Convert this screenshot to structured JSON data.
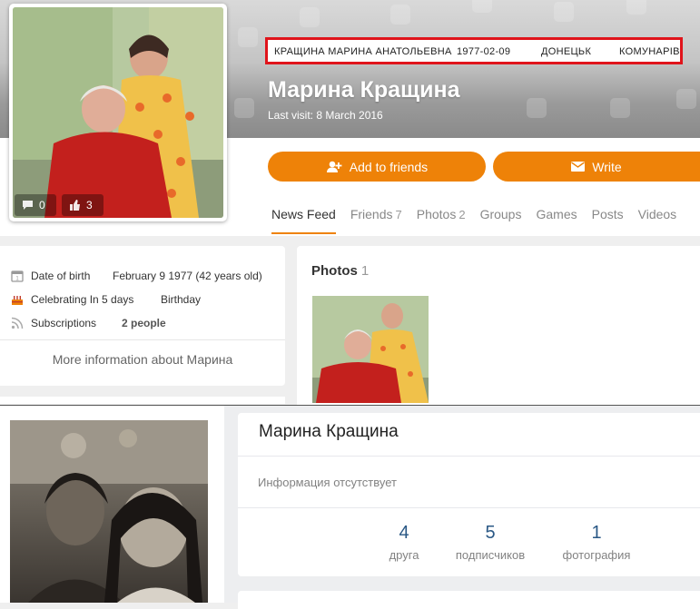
{
  "ok_profile": {
    "highlight": {
      "full_name": "КРАЩИНА МАРИНА АНАТОЛЬЕВНА",
      "dob": "1977-02-09",
      "city": "ДОНЕЦЬК",
      "street": "КОМУНАРІВ"
    },
    "name": "Марина Кращина",
    "last_visit": "Last visit: 8 March 2016",
    "avatar_comments": "0",
    "avatar_likes": "3",
    "add_friends_label": "Add to friends",
    "write_label": "Write",
    "tabs": [
      {
        "label": "News Feed",
        "count": ""
      },
      {
        "label": "Friends",
        "count": "7"
      },
      {
        "label": "Photos",
        "count": "2"
      },
      {
        "label": "Groups",
        "count": ""
      },
      {
        "label": "Games",
        "count": ""
      },
      {
        "label": "Posts",
        "count": ""
      },
      {
        "label": "Videos",
        "count": ""
      }
    ],
    "details": [
      {
        "icon": "calendar-icon",
        "label": "Date of birth",
        "value": "February 9 1977 (42 years old)"
      },
      {
        "icon": "cake-icon",
        "label": "Celebrating In 5 days",
        "value": "Birthday"
      },
      {
        "icon": "rss-icon",
        "label": "Subscriptions",
        "value": "2 people"
      }
    ],
    "more_info": "More information about Марина",
    "photos_title": "Photos",
    "photos_count": "1"
  },
  "vk_profile": {
    "name": "Марина Кращина",
    "no_info": "Информация отсутствует",
    "stats": [
      {
        "num": "4",
        "label": "друга"
      },
      {
        "num": "5",
        "label": "подписчиков"
      },
      {
        "num": "1",
        "label": "фотография"
      }
    ]
  },
  "colors": {
    "accent": "#ee8208",
    "highlight_border": "#e0141b",
    "vk_link": "#2a5885"
  }
}
